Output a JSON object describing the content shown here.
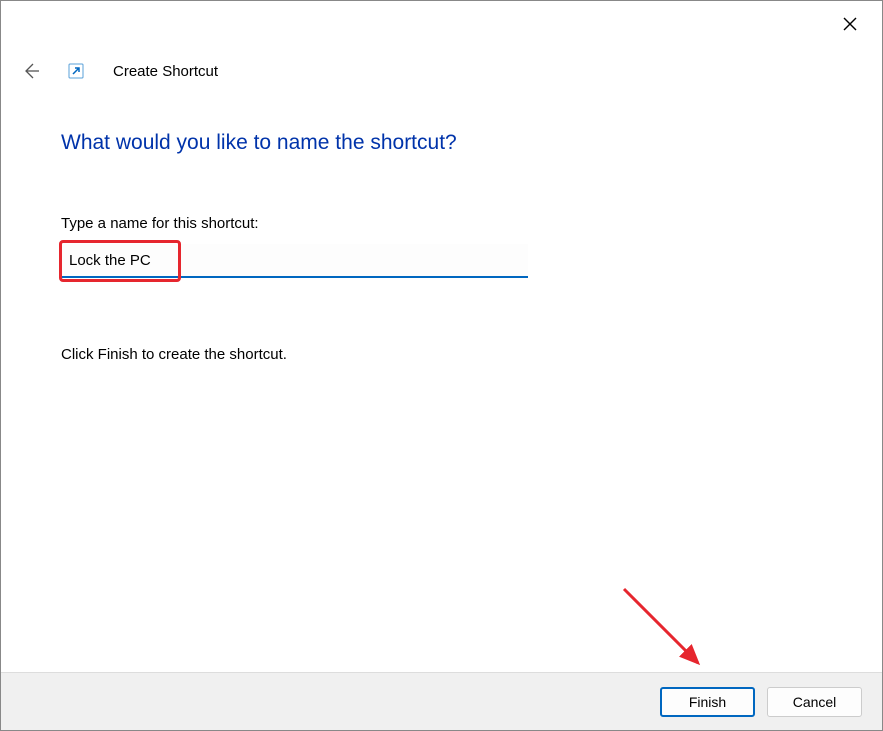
{
  "window": {
    "title": "Create Shortcut"
  },
  "wizard": {
    "heading": "What would you like to name the shortcut?",
    "field_label": "Type a name for this shortcut:",
    "input_value": "Lock the PC",
    "instruction": "Click Finish to create the shortcut."
  },
  "footer": {
    "primary_label": "Finish",
    "cancel_label": "Cancel"
  },
  "annotation": {
    "highlight_color": "#e6262e",
    "arrow_color": "#e6262e"
  }
}
